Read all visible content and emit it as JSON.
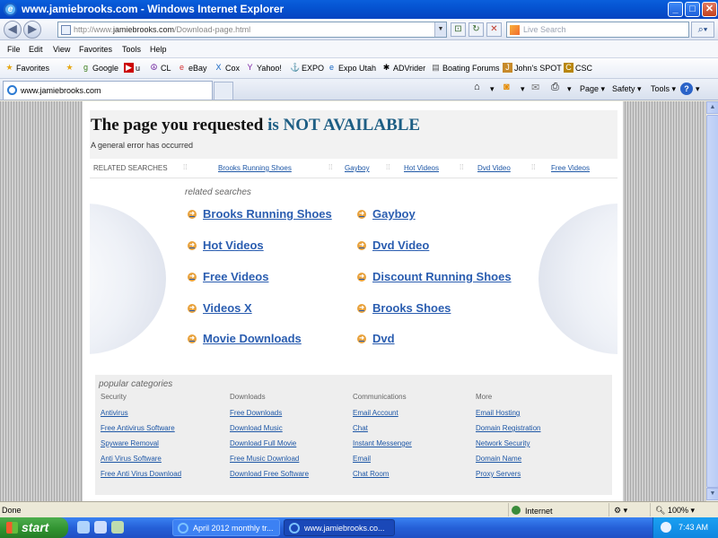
{
  "window": {
    "title": "www.jamiebrooks.com - Windows Internet Explorer",
    "min": "_",
    "max": "□",
    "close": "✕"
  },
  "address": {
    "url_prefix": "http://www.",
    "url_domain": "jamiebrooks.com",
    "url_path": "/Download-page.html"
  },
  "search": {
    "placeholder": "Live Search"
  },
  "menu": [
    "File",
    "Edit",
    "View",
    "Favorites",
    "Tools",
    "Help"
  ],
  "favorites": {
    "label": "Favorites",
    "items": [
      "Google",
      "u",
      "CL",
      "eBay",
      "Cox",
      "Yahoo!",
      "EXPO",
      "Expo Utah",
      "ADVrider",
      "Boating Forums",
      "John's SPOT",
      "CSC"
    ]
  },
  "tab": {
    "label": "www.jamiebrooks.com"
  },
  "commandbar": {
    "page": "Page",
    "safety": "Safety",
    "tools": "Tools"
  },
  "page": {
    "heading_main": "The page you requested ",
    "heading_emph": "is NOT AVAILABLE",
    "subheading": "A general error has occurred",
    "related_label": "RELATED SEARCHES",
    "related_bar": [
      "Brooks Running Shoes",
      "Gayboy",
      "Hot Videos",
      "Dvd Video",
      "Free Videos"
    ],
    "related_heading": "related searches",
    "related_links_left": [
      "Brooks Running Shoes",
      "Hot Videos",
      "Free Videos",
      "Videos X",
      "Movie Downloads"
    ],
    "related_links_right": [
      "Gayboy",
      "Dvd Video",
      "Discount Running Shoes",
      "Brooks Shoes",
      "Dvd"
    ],
    "popular_heading": "popular categories",
    "categories": [
      {
        "title": "Security",
        "links": [
          "Antivirus",
          "Free Antivirus Software",
          "Spyware Removal",
          "Anti Virus Software",
          "Free Anti Virus Download"
        ]
      },
      {
        "title": "Downloads",
        "links": [
          "Free Downloads",
          "Download Music",
          "Download Full Movie",
          "Free Music Download",
          "Download Free Software"
        ]
      },
      {
        "title": "Communications",
        "links": [
          "Email Account",
          "Chat",
          "Instant Messenger",
          "Email",
          "Chat Room"
        ]
      },
      {
        "title": "More",
        "links": [
          "Email Hosting",
          "Domain Registration",
          "Network Security",
          "Domain Name",
          "Proxy Servers"
        ]
      }
    ]
  },
  "status": {
    "left": "Done",
    "zone": "Internet",
    "zoom": "100%"
  },
  "taskbar": {
    "start": "start",
    "tasks": [
      "April 2012 monthly tr...",
      "www.jamiebrooks.co..."
    ],
    "time": "7:43 AM"
  }
}
